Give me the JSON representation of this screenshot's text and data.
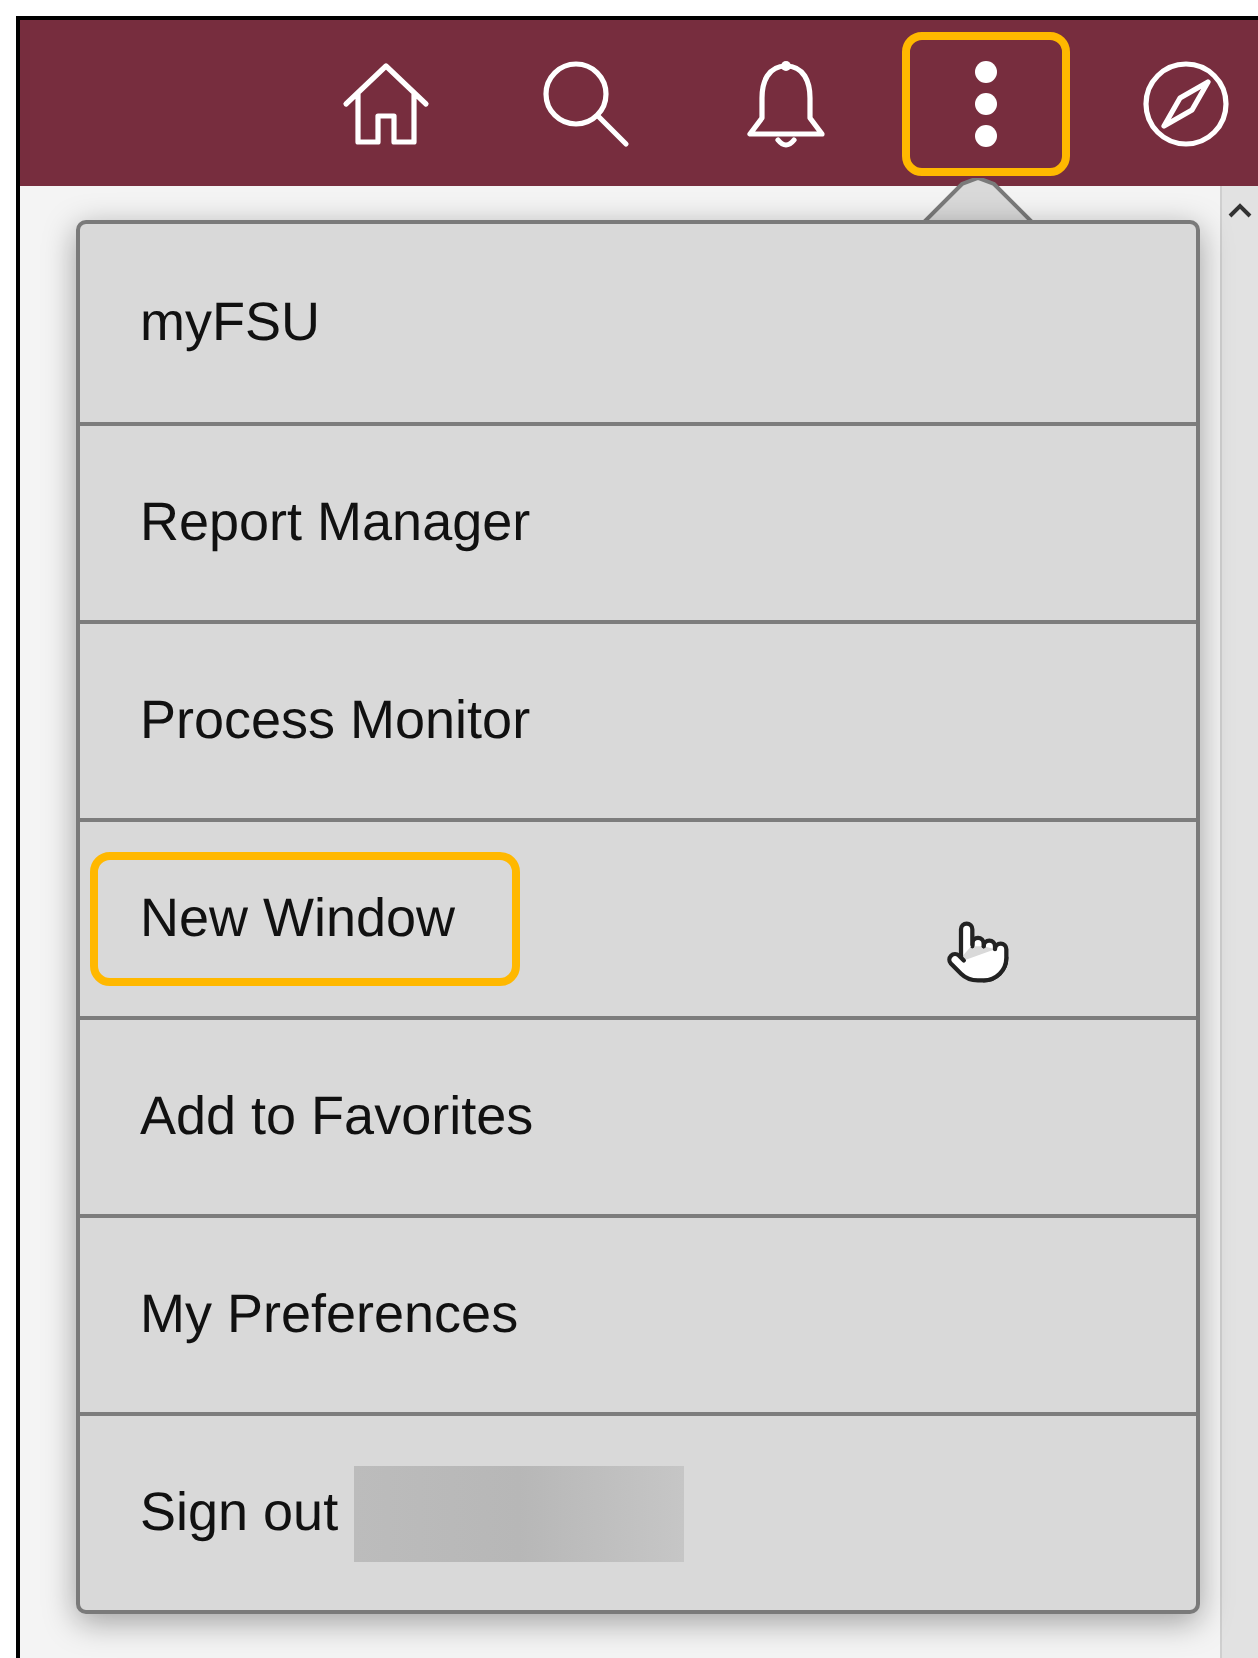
{
  "header": {
    "actions": [
      {
        "kind": "home",
        "highlighted": false
      },
      {
        "kind": "search",
        "highlighted": false
      },
      {
        "kind": "notifications",
        "highlighted": false
      },
      {
        "kind": "more",
        "highlighted": true
      },
      {
        "kind": "navigator",
        "highlighted": false
      }
    ]
  },
  "menu": {
    "items": [
      {
        "label": "myFSU",
        "highlighted": false,
        "redacted": false
      },
      {
        "label": "Report Manager",
        "highlighted": false,
        "redacted": false
      },
      {
        "label": "Process Monitor",
        "highlighted": false,
        "redacted": false
      },
      {
        "label": "New Window",
        "highlighted": true,
        "redacted": false
      },
      {
        "label": "Add to Favorites",
        "highlighted": false,
        "redacted": false
      },
      {
        "label": "My Preferences",
        "highlighted": false,
        "redacted": false
      },
      {
        "label": "Sign out",
        "highlighted": false,
        "redacted": true
      }
    ]
  }
}
